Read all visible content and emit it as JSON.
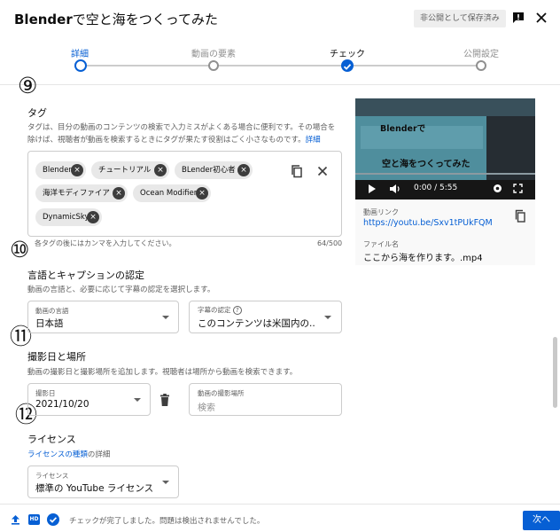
{
  "header": {
    "title_bold": "Blender",
    "title_rest": "で空と海をつくってみた",
    "saved_badge": "非公開として保存済み"
  },
  "stepper": {
    "steps": [
      "詳細",
      "動画の要素",
      "チェック",
      "公開設定"
    ]
  },
  "annotations": [
    "⑨",
    "⑩",
    "⑪",
    "⑫"
  ],
  "tags": {
    "title": "タグ",
    "description_line1": "タグは、目分の動画のコンテンツの検索で入力ミスがよくある場合に便利です。その場合を",
    "description_line2": "除けば、視聴者が動画を検索するときにタグが果たす役割はごく小さなものです。",
    "more_link": "詳細",
    "chips": [
      "Blender",
      "チュートリアル",
      "BLender初心者",
      "海洋モディファイア",
      "Ocean Modifier",
      "DynamicSky"
    ],
    "helper": "各タグの後にはカンマを入力してください。",
    "counter": "64/500"
  },
  "language": {
    "title": "言語とキャプションの認定",
    "description": "動画の言語と、必要に応じて字幕の認定を選択します。",
    "video_language_label": "動画の言語",
    "video_language_value": "日本語",
    "caption_cert_label": "字幕の認定",
    "caption_cert_value": "このコンテンツは米国内の..."
  },
  "recording": {
    "title": "撮影日と場所",
    "description": "動画の撮影日と撮影場所を追加します。視聴者は場所から動画を検索できます。",
    "date_label": "撮影日",
    "date_value": "2021/10/20",
    "location_label": "動画の撮影場所",
    "location_placeholder": "検索"
  },
  "license": {
    "title": "ライセンス",
    "link_text": "ライセンスの種類",
    "link_suffix": "の詳細",
    "field_label": "ライセンス",
    "field_value": "標準の YouTube ライセンス"
  },
  "video": {
    "thumb_text1": "Blenderで",
    "thumb_text2": "空と海をつくってみた",
    "time": "0:00 / 5:55",
    "link_label": "動画リンク",
    "link_url": "https://youtu.be/Sxv1tPUkFQM",
    "file_label": "ファイル名",
    "file_name": "ここから海を作ります。.mp4"
  },
  "footer": {
    "hd_badge": "HD",
    "status": "チェックが完了しました。問題は検出されませんでした。",
    "next_label": "次へ"
  },
  "colors": {
    "accent": "#065fd4",
    "chip_bg": "#e8e8e8"
  }
}
